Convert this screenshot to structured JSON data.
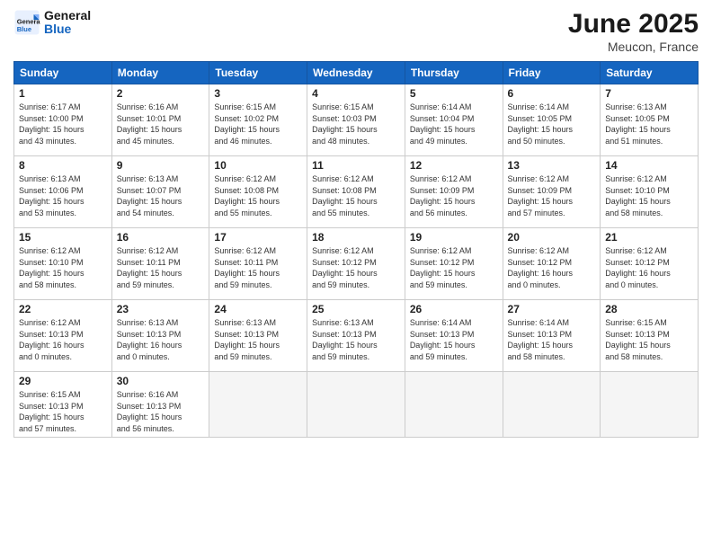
{
  "header": {
    "logo_line1": "General",
    "logo_line2": "Blue",
    "month_title": "June 2025",
    "location": "Meucon, France"
  },
  "weekdays": [
    "Sunday",
    "Monday",
    "Tuesday",
    "Wednesday",
    "Thursday",
    "Friday",
    "Saturday"
  ],
  "weeks": [
    [
      {
        "day": "1",
        "info": "Sunrise: 6:17 AM\nSunset: 10:00 PM\nDaylight: 15 hours\nand 43 minutes."
      },
      {
        "day": "2",
        "info": "Sunrise: 6:16 AM\nSunset: 10:01 PM\nDaylight: 15 hours\nand 45 minutes."
      },
      {
        "day": "3",
        "info": "Sunrise: 6:15 AM\nSunset: 10:02 PM\nDaylight: 15 hours\nand 46 minutes."
      },
      {
        "day": "4",
        "info": "Sunrise: 6:15 AM\nSunset: 10:03 PM\nDaylight: 15 hours\nand 48 minutes."
      },
      {
        "day": "5",
        "info": "Sunrise: 6:14 AM\nSunset: 10:04 PM\nDaylight: 15 hours\nand 49 minutes."
      },
      {
        "day": "6",
        "info": "Sunrise: 6:14 AM\nSunset: 10:05 PM\nDaylight: 15 hours\nand 50 minutes."
      },
      {
        "day": "7",
        "info": "Sunrise: 6:13 AM\nSunset: 10:05 PM\nDaylight: 15 hours\nand 51 minutes."
      }
    ],
    [
      {
        "day": "8",
        "info": "Sunrise: 6:13 AM\nSunset: 10:06 PM\nDaylight: 15 hours\nand 53 minutes."
      },
      {
        "day": "9",
        "info": "Sunrise: 6:13 AM\nSunset: 10:07 PM\nDaylight: 15 hours\nand 54 minutes."
      },
      {
        "day": "10",
        "info": "Sunrise: 6:12 AM\nSunset: 10:08 PM\nDaylight: 15 hours\nand 55 minutes."
      },
      {
        "day": "11",
        "info": "Sunrise: 6:12 AM\nSunset: 10:08 PM\nDaylight: 15 hours\nand 55 minutes."
      },
      {
        "day": "12",
        "info": "Sunrise: 6:12 AM\nSunset: 10:09 PM\nDaylight: 15 hours\nand 56 minutes."
      },
      {
        "day": "13",
        "info": "Sunrise: 6:12 AM\nSunset: 10:09 PM\nDaylight: 15 hours\nand 57 minutes."
      },
      {
        "day": "14",
        "info": "Sunrise: 6:12 AM\nSunset: 10:10 PM\nDaylight: 15 hours\nand 58 minutes."
      }
    ],
    [
      {
        "day": "15",
        "info": "Sunrise: 6:12 AM\nSunset: 10:10 PM\nDaylight: 15 hours\nand 58 minutes."
      },
      {
        "day": "16",
        "info": "Sunrise: 6:12 AM\nSunset: 10:11 PM\nDaylight: 15 hours\nand 59 minutes."
      },
      {
        "day": "17",
        "info": "Sunrise: 6:12 AM\nSunset: 10:11 PM\nDaylight: 15 hours\nand 59 minutes."
      },
      {
        "day": "18",
        "info": "Sunrise: 6:12 AM\nSunset: 10:12 PM\nDaylight: 15 hours\nand 59 minutes."
      },
      {
        "day": "19",
        "info": "Sunrise: 6:12 AM\nSunset: 10:12 PM\nDaylight: 15 hours\nand 59 minutes."
      },
      {
        "day": "20",
        "info": "Sunrise: 6:12 AM\nSunset: 10:12 PM\nDaylight: 16 hours\nand 0 minutes."
      },
      {
        "day": "21",
        "info": "Sunrise: 6:12 AM\nSunset: 10:12 PM\nDaylight: 16 hours\nand 0 minutes."
      }
    ],
    [
      {
        "day": "22",
        "info": "Sunrise: 6:12 AM\nSunset: 10:13 PM\nDaylight: 16 hours\nand 0 minutes."
      },
      {
        "day": "23",
        "info": "Sunrise: 6:13 AM\nSunset: 10:13 PM\nDaylight: 16 hours\nand 0 minutes."
      },
      {
        "day": "24",
        "info": "Sunrise: 6:13 AM\nSunset: 10:13 PM\nDaylight: 15 hours\nand 59 minutes."
      },
      {
        "day": "25",
        "info": "Sunrise: 6:13 AM\nSunset: 10:13 PM\nDaylight: 15 hours\nand 59 minutes."
      },
      {
        "day": "26",
        "info": "Sunrise: 6:14 AM\nSunset: 10:13 PM\nDaylight: 15 hours\nand 59 minutes."
      },
      {
        "day": "27",
        "info": "Sunrise: 6:14 AM\nSunset: 10:13 PM\nDaylight: 15 hours\nand 58 minutes."
      },
      {
        "day": "28",
        "info": "Sunrise: 6:15 AM\nSunset: 10:13 PM\nDaylight: 15 hours\nand 58 minutes."
      }
    ],
    [
      {
        "day": "29",
        "info": "Sunrise: 6:15 AM\nSunset: 10:13 PM\nDaylight: 15 hours\nand 57 minutes."
      },
      {
        "day": "30",
        "info": "Sunrise: 6:16 AM\nSunset: 10:13 PM\nDaylight: 15 hours\nand 56 minutes."
      },
      {
        "day": "",
        "info": ""
      },
      {
        "day": "",
        "info": ""
      },
      {
        "day": "",
        "info": ""
      },
      {
        "day": "",
        "info": ""
      },
      {
        "day": "",
        "info": ""
      }
    ]
  ]
}
